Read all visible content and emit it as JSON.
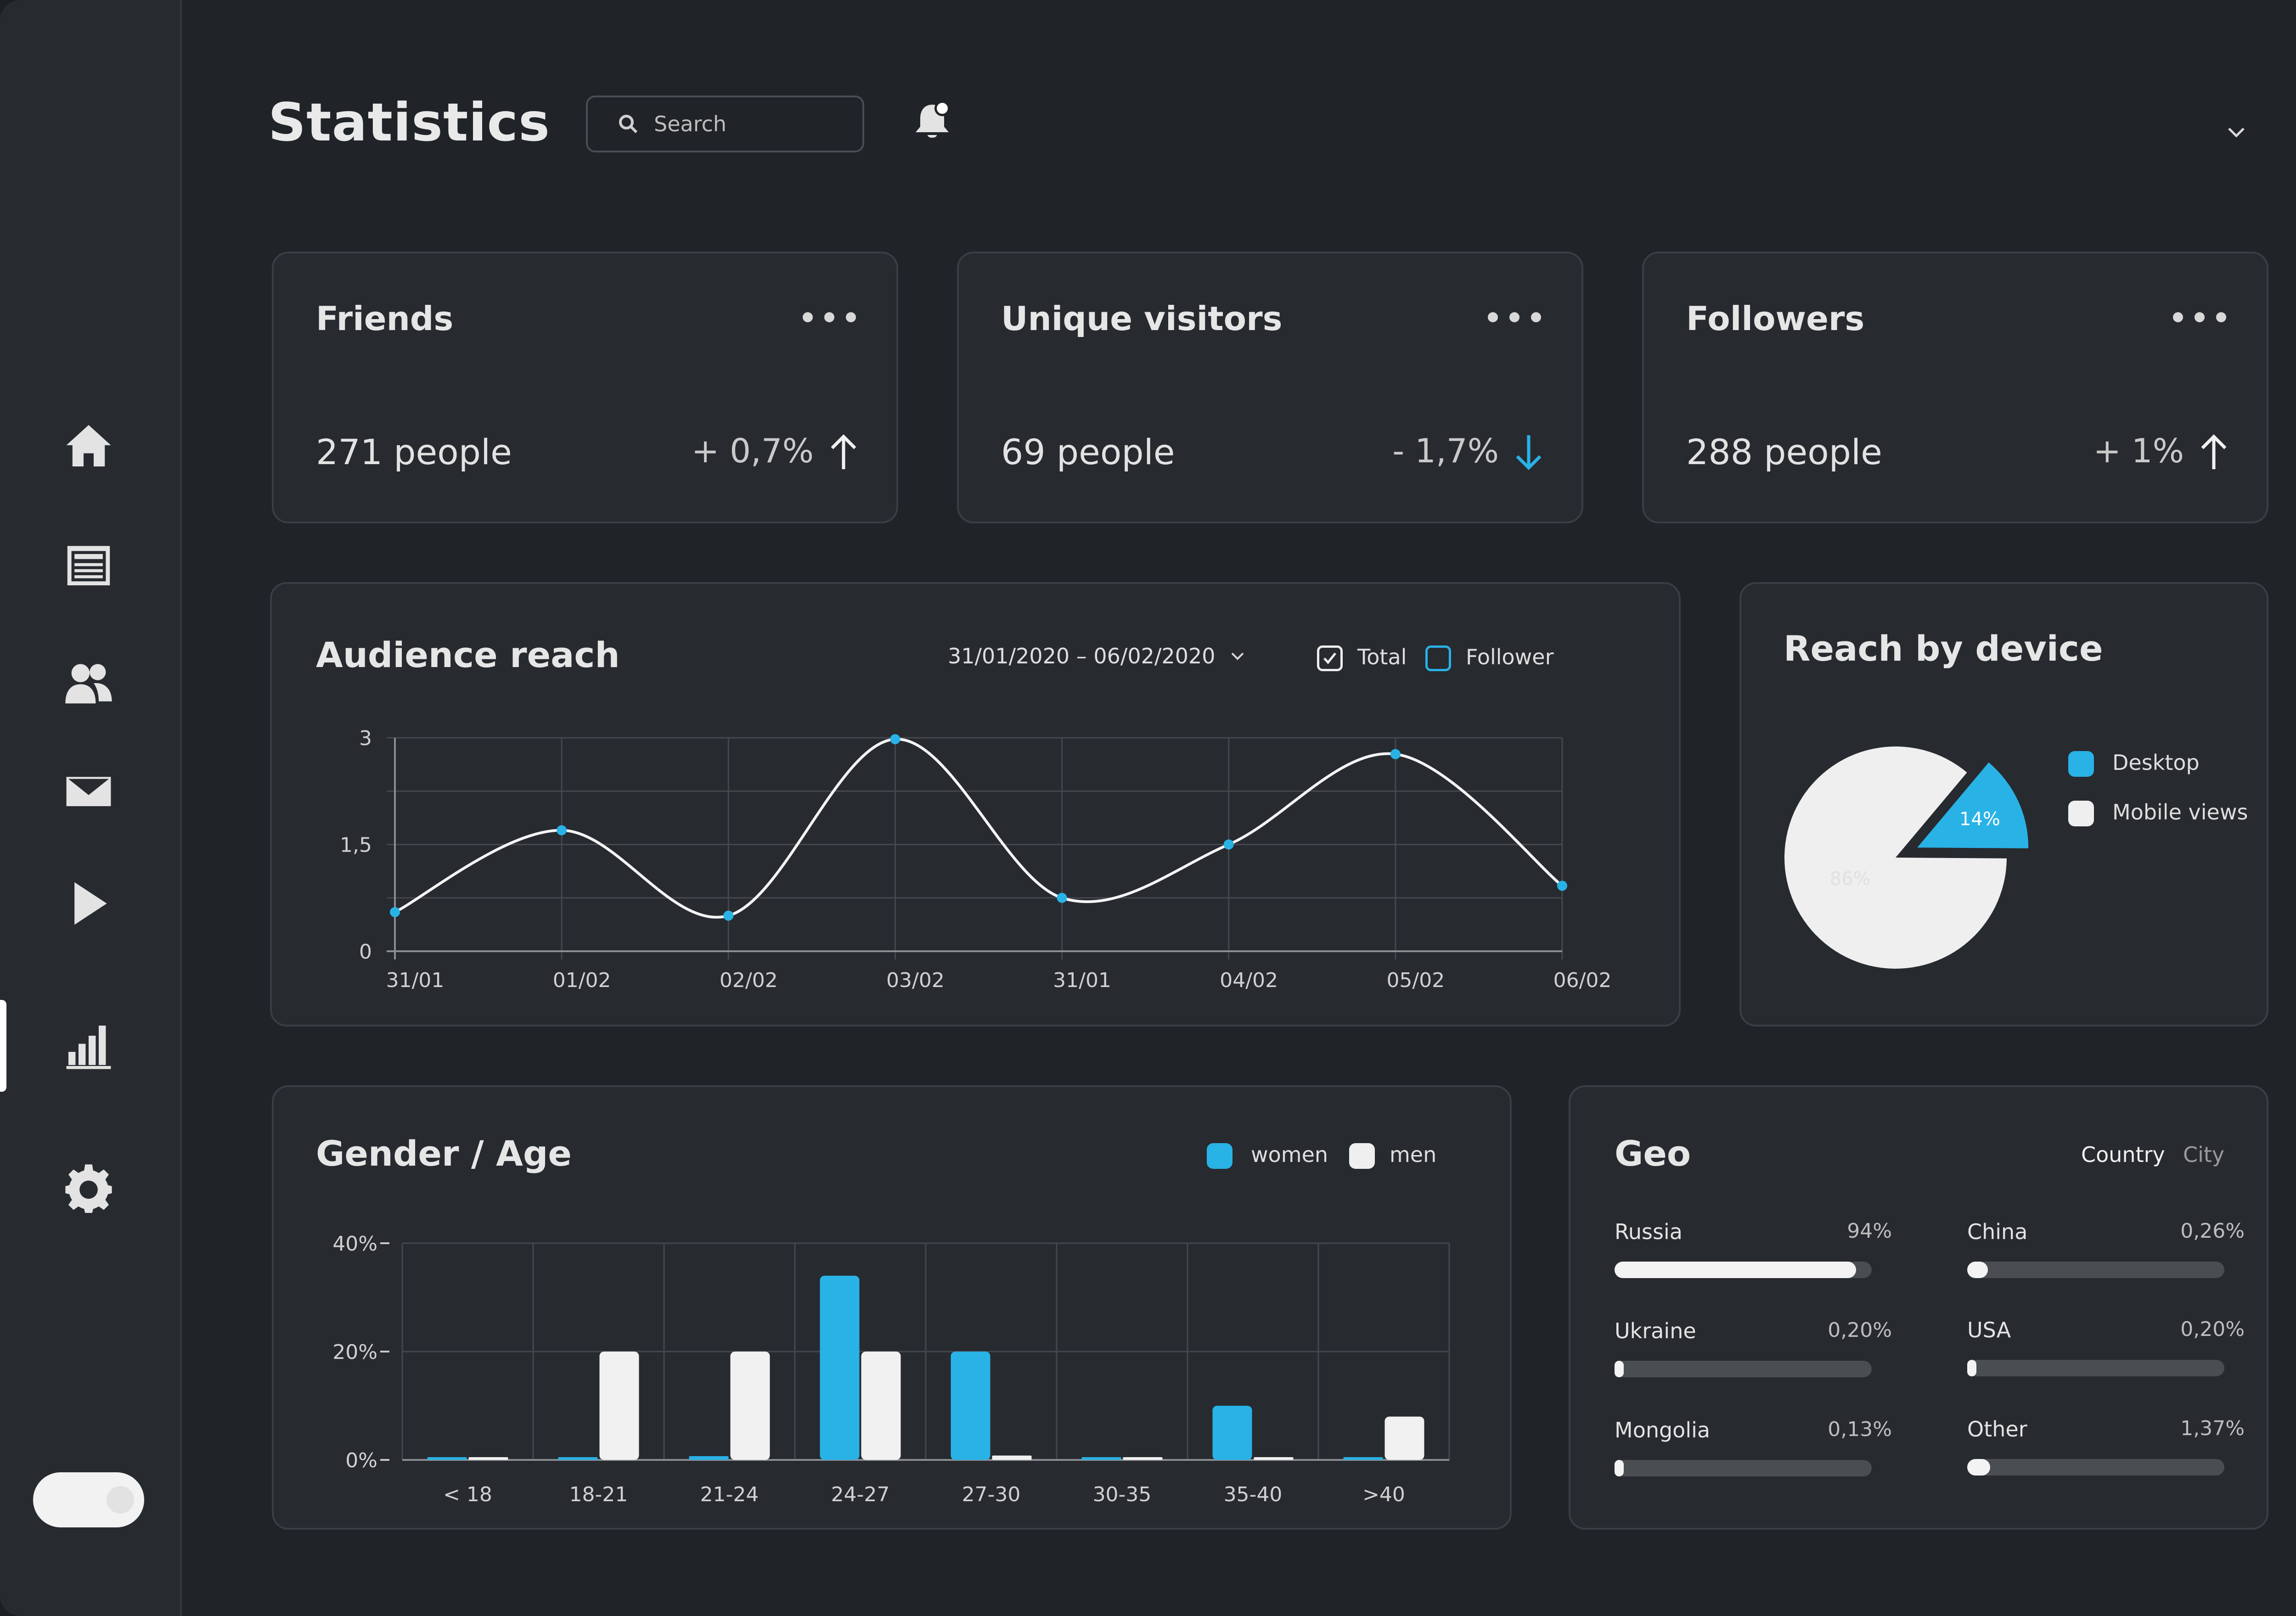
{
  "header": {
    "title": "Statistics",
    "search_placeholder": "Search"
  },
  "sidebar": {
    "items": [
      {
        "icon": "home-icon",
        "active": false
      },
      {
        "icon": "news-icon",
        "active": false
      },
      {
        "icon": "users-icon",
        "active": false
      },
      {
        "icon": "mail-icon",
        "active": false
      },
      {
        "icon": "play-icon",
        "active": false
      },
      {
        "icon": "bar-chart-icon",
        "active": true
      },
      {
        "icon": "gear-icon",
        "active": false
      }
    ]
  },
  "stats": [
    {
      "title": "Friends",
      "value": "271 people",
      "change": "+ 0,7%",
      "direction": "up",
      "color": "#f1f1f1"
    },
    {
      "title": "Unique visitors",
      "value": "69 people",
      "change": "- 1,7%",
      "direction": "down",
      "color": "#29b2e6"
    },
    {
      "title": "Followers",
      "value": "288 people",
      "change": "+ 1%",
      "direction": "up",
      "color": "#f1f1f1"
    }
  ],
  "audience": {
    "title": "Audience reach",
    "date_range": "31/01/2020 – 06/02/2020",
    "legend_total": "Total",
    "legend_follower": "Follower"
  },
  "device": {
    "title": "Reach by device",
    "legend_desktop": "Desktop",
    "legend_mobile": "Mobile views",
    "desktop_pct": "14%",
    "mobile_pct": "86%"
  },
  "gender": {
    "title": "Gender / Age",
    "legend_women": "women",
    "legend_men": "men"
  },
  "geo": {
    "title": "Geo",
    "tab_country": "Country",
    "tab_city": "City",
    "rows": [
      {
        "name": "Russia",
        "pct": "94%",
        "fraction": 0.94
      },
      {
        "name": "China",
        "pct": "0,26%",
        "fraction": 0.08
      },
      {
        "name": "Ukraine",
        "pct": "0,20%",
        "fraction": 0.03
      },
      {
        "name": "USA",
        "pct": "0,20%",
        "fraction": 0.03
      },
      {
        "name": "Mongolia",
        "pct": "0,13%",
        "fraction": 0.02
      },
      {
        "name": "Other",
        "pct": "1,37%",
        "fraction": 0.09
      }
    ]
  },
  "colors": {
    "accent": "#29b2e6",
    "light": "#f1f1f1",
    "card": "#272a2f",
    "background": "#202327"
  },
  "chart_data": [
    {
      "type": "line",
      "title": "Audience reach",
      "x": [
        "31/01",
        "01/02",
        "02/02",
        "03/02",
        "31/01",
        "04/02",
        "05/02",
        "06/02"
      ],
      "points": [
        {
          "x": 0.0,
          "y": 0.55
        },
        {
          "x": 1.0,
          "y": 1.7
        },
        {
          "x": 2.0,
          "y": 0.5
        },
        {
          "x": 3.0,
          "y": 2.98
        },
        {
          "x": 4.0,
          "y": 0.75
        },
        {
          "x": 5.0,
          "y": 1.5
        },
        {
          "x": 6.0,
          "y": 2.77
        },
        {
          "x": 7.0,
          "y": 0.92
        }
      ],
      "x_labels": [
        {
          "x": 0.0,
          "label": "31/01"
        },
        {
          "x": 1.0,
          "label": "01/02"
        },
        {
          "x": 2.0,
          "label": "02/02"
        },
        {
          "x": 3.0,
          "label": "03/02"
        },
        {
          "x": 4.0,
          "label": "31/01"
        },
        {
          "x": 5.0,
          "label": "04/02"
        },
        {
          "x": 6.0,
          "label": "05/02"
        },
        {
          "x": 7.0,
          "label": "06/02"
        }
      ],
      "yticks": [
        {
          "v": 0,
          "label": "0"
        },
        {
          "v": 1.5,
          "label": "1,5"
        },
        {
          "v": 3,
          "label": "3"
        }
      ],
      "ylim": [
        0,
        3
      ],
      "grid": true
    },
    {
      "type": "pie",
      "title": "Reach by device",
      "slices": [
        {
          "label": "Desktop",
          "value": 14,
          "text": "14%",
          "color": "#29b2e6"
        },
        {
          "label": "Mobile views",
          "value": 86,
          "text": "86%",
          "color": "#efefef"
        }
      ]
    },
    {
      "type": "bar",
      "title": "Gender / Age",
      "categories": [
        "< 18",
        "18-21",
        "21-24",
        "24-27",
        "27-30",
        "30-35",
        "35-40",
        ">40"
      ],
      "series": [
        {
          "name": "women",
          "color": "#29b2e6",
          "values": [
            0.5,
            0.3,
            0.7,
            34,
            20,
            0.5,
            10,
            0.5
          ]
        },
        {
          "name": "men",
          "color": "#f1f1f1",
          "values": [
            0.5,
            20,
            20,
            20,
            0.8,
            0.5,
            0.5,
            8
          ]
        }
      ],
      "yticks": [
        {
          "v": 0,
          "label": "0%"
        },
        {
          "v": 20,
          "label": "20%"
        },
        {
          "v": 40,
          "label": "40%"
        }
      ],
      "ylim": [
        0,
        40
      ],
      "grid": true
    }
  ]
}
